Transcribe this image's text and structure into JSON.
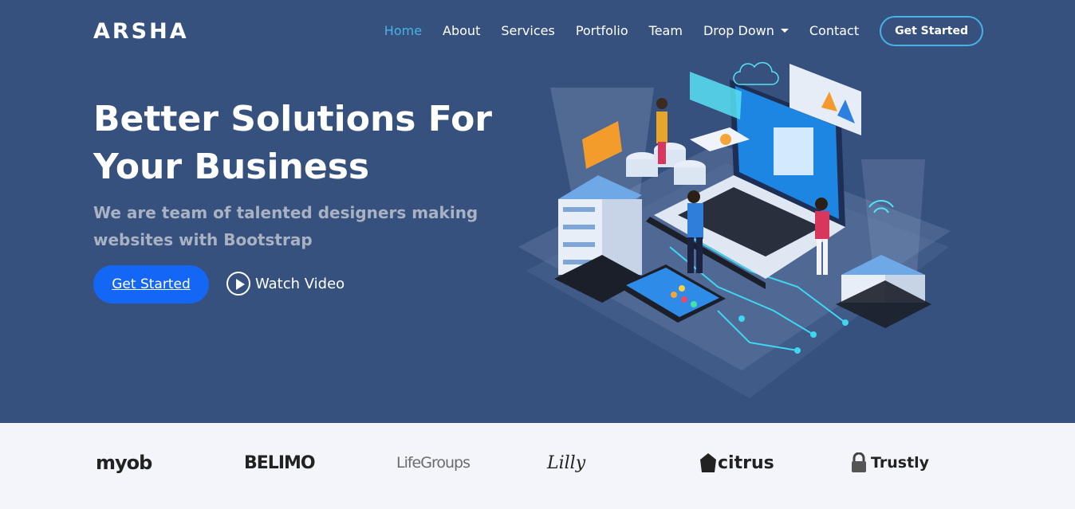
{
  "brand": {
    "name": "ARSHA"
  },
  "nav": {
    "items": [
      {
        "label": "Home",
        "active": true
      },
      {
        "label": "About"
      },
      {
        "label": "Services"
      },
      {
        "label": "Portfolio"
      },
      {
        "label": "Team"
      },
      {
        "label": "Drop Down",
        "has_dropdown": true
      },
      {
        "label": "Contact"
      }
    ],
    "cta": "Get Started"
  },
  "hero": {
    "title_line1": "Better Solutions For",
    "title_line2": "Your Business",
    "subtitle": "We are team of talented designers making websites with Bootstrap",
    "primary_button": "Get Started",
    "video_link": "Watch Video"
  },
  "clients": [
    {
      "name": "myob"
    },
    {
      "name": "BELIMO"
    },
    {
      "name": "LifeGroups"
    },
    {
      "name": "Lilly"
    },
    {
      "name": "citrus"
    },
    {
      "name": "Trustly"
    }
  ],
  "colors": {
    "hero_bg": "#37517e",
    "accent": "#47b2e4",
    "button": "#1466f5",
    "clients_bg": "#f3f5fa"
  },
  "icons": [
    "play-icon",
    "chevron-down-icon",
    "lock-icon"
  ]
}
